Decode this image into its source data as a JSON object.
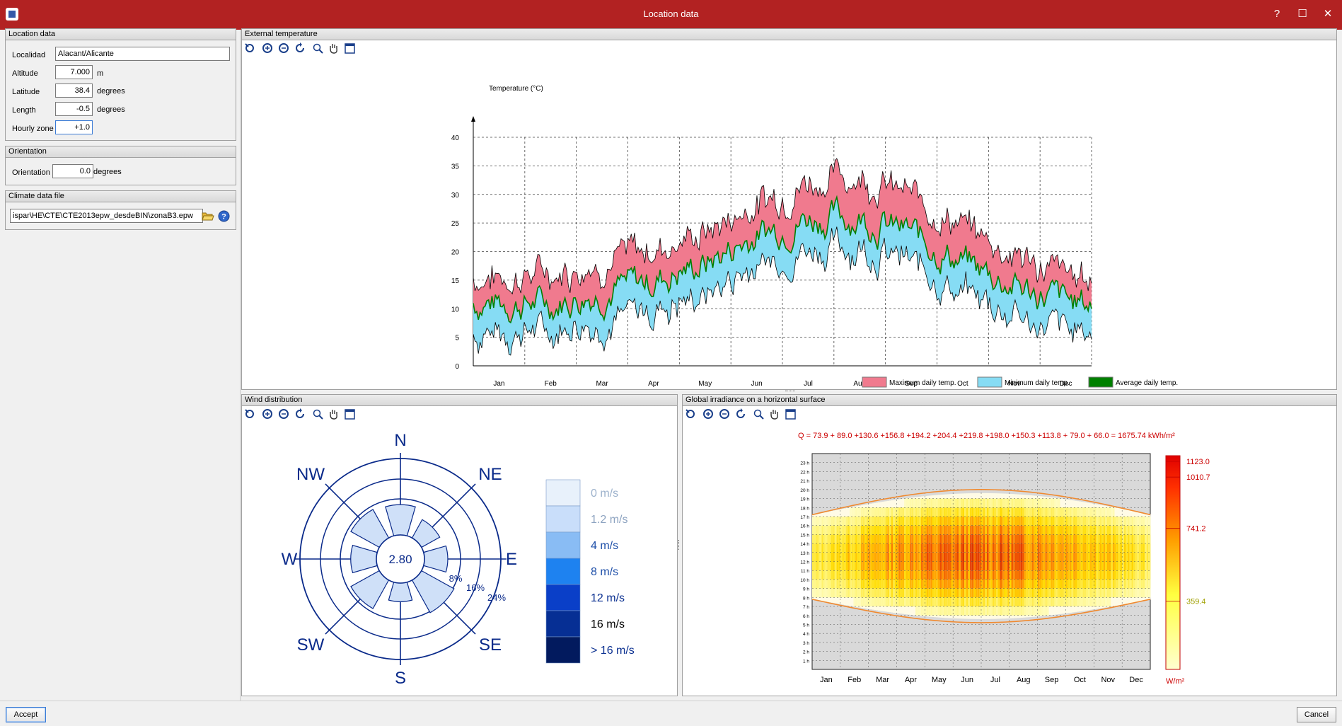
{
  "window": {
    "title": "Location data",
    "help_label": "?",
    "maximize_label": "☐",
    "close_label": "✕"
  },
  "location": {
    "header": "Location data",
    "locality_label": "Localidad",
    "locality_value": "Alacant/Alicante",
    "altitude_label": "Altitude",
    "altitude_value": "7.000",
    "altitude_unit": "m",
    "latitude_label": "Latitude",
    "latitude_value": "38.4",
    "latitude_unit": "degrees",
    "length_label": "Length",
    "length_value": "-0.5",
    "length_unit": "degrees",
    "zone_label": "Hourly zone",
    "zone_value": "+1.0"
  },
  "orientation": {
    "header": "Orientation",
    "label": "Orientation",
    "value": "0.0",
    "unit": "degrees"
  },
  "climate": {
    "header": "Climate data file",
    "value": "ispar\\HE\\CTE\\CTE2013epw_desdeBIN\\zonaB3.epw"
  },
  "panels": {
    "temp_header": "External temperature",
    "wind_header": "Wind distribution",
    "irr_header": "Global irradiance on a horizontal surface"
  },
  "temp_chart": {
    "ylabel": "Temperature (°C)",
    "yticks": [
      "0",
      "5",
      "10",
      "15",
      "20",
      "25",
      "30",
      "35",
      "40"
    ],
    "months": [
      "Jan",
      "Feb",
      "Mar",
      "Apr",
      "May",
      "Jun",
      "Jul",
      "Aug",
      "Sep",
      "Oct",
      "Nov",
      "Dec"
    ],
    "legend": [
      "Maximum daily temp.",
      "Minimum daily temp.",
      "Average daily temp."
    ],
    "colors": {
      "max": "#f07a8e",
      "min": "#86dcf4",
      "avg": "#008000"
    }
  },
  "chart_data": [
    {
      "type": "area",
      "title": "",
      "ylabel": "Temperature (°C)",
      "ylim": [
        0,
        40
      ],
      "categories": [
        "Jan",
        "Feb",
        "Mar",
        "Apr",
        "May",
        "Jun",
        "Jul",
        "Aug",
        "Sep",
        "Oct",
        "Nov",
        "Dec"
      ],
      "series": [
        {
          "name": "Maximum daily temp.",
          "values": [
            14,
            15,
            17,
            19,
            22,
            27,
            31,
            32,
            28,
            23,
            18,
            14
          ]
        },
        {
          "name": "Average daily temp.",
          "values": [
            11,
            11,
            13,
            15,
            18,
            23,
            26,
            26,
            23,
            18,
            14,
            11
          ]
        },
        {
          "name": "Minimum daily temp.",
          "values": [
            7,
            8,
            9,
            11,
            14,
            19,
            22,
            22,
            19,
            14,
            10,
            7
          ]
        }
      ],
      "legend": "bottom"
    },
    {
      "type": "heatmap",
      "title": "Global irradiance on a horizontal surface",
      "monthly_q": [
        73.9,
        89.0,
        130.6,
        156.8,
        194.2,
        204.4,
        219.8,
        198.0,
        150.3,
        113.8,
        79.0,
        66.0
      ],
      "total": 1675.74,
      "unit": "kWh/m²",
      "scale_labels": [
        "1123.0",
        "1010.7",
        "741.2",
        "359.4"
      ],
      "scale_unit": "W/m²"
    }
  ],
  "wind": {
    "center_value": "2.80",
    "directions": {
      "N": "N",
      "NE": "NE",
      "E": "E",
      "SE": "SE",
      "S": "S",
      "SW": "SW",
      "W": "W",
      "NW": "NW"
    },
    "rings": [
      "8%",
      "16%",
      "24%"
    ],
    "freqs": {
      "N": 13,
      "NE": 9,
      "E": 10,
      "SE": 16,
      "S": 8,
      "SW": 14,
      "W": 11,
      "NW": 14
    },
    "legend": [
      "0 m/s",
      "1.2 m/s",
      "4 m/s",
      "8 m/s",
      "12 m/s",
      "16 m/s",
      "> 16 m/s"
    ],
    "legend_colors": [
      "#e8f1fb",
      "#c9defa",
      "#89bcf4",
      "#1e82f0",
      "#0a3fc8",
      "#062f94",
      "#021a5e"
    ],
    "legend_text_colors": [
      "#9db2cc",
      "#8da3c0",
      "#1e4fa8",
      "#1e4fa8",
      "#0a2f90",
      "#000000",
      "#0a2f90"
    ]
  },
  "irradiance": {
    "q_text": "Q =  73.9  +  89.0  +130.6 +156.8 +194.2 +204.4 +219.8 +198.0 +150.3 +113.8 +  79.0  +  66.0   = 1675.74 kWh/m²",
    "hours": [
      "1 h",
      "2 h",
      "3 h",
      "4 h",
      "5 h",
      "6 h",
      "7 h",
      "8 h",
      "9 h",
      "10 h",
      "11 h",
      "12 h",
      "13 h",
      "14 h",
      "15 h",
      "16 h",
      "17 h",
      "18 h",
      "19 h",
      "20 h",
      "21 h",
      "22 h",
      "23 h"
    ],
    "months": [
      "Jan",
      "Feb",
      "Mar",
      "Apr",
      "May",
      "Jun",
      "Jul",
      "Aug",
      "Sep",
      "Oct",
      "Nov",
      "Dec"
    ],
    "scale": [
      "1123.0",
      "1010.7",
      "741.2",
      "359.4"
    ],
    "unit": "W/m²"
  },
  "buttons": {
    "accept": "Accept",
    "cancel": "Cancel"
  }
}
